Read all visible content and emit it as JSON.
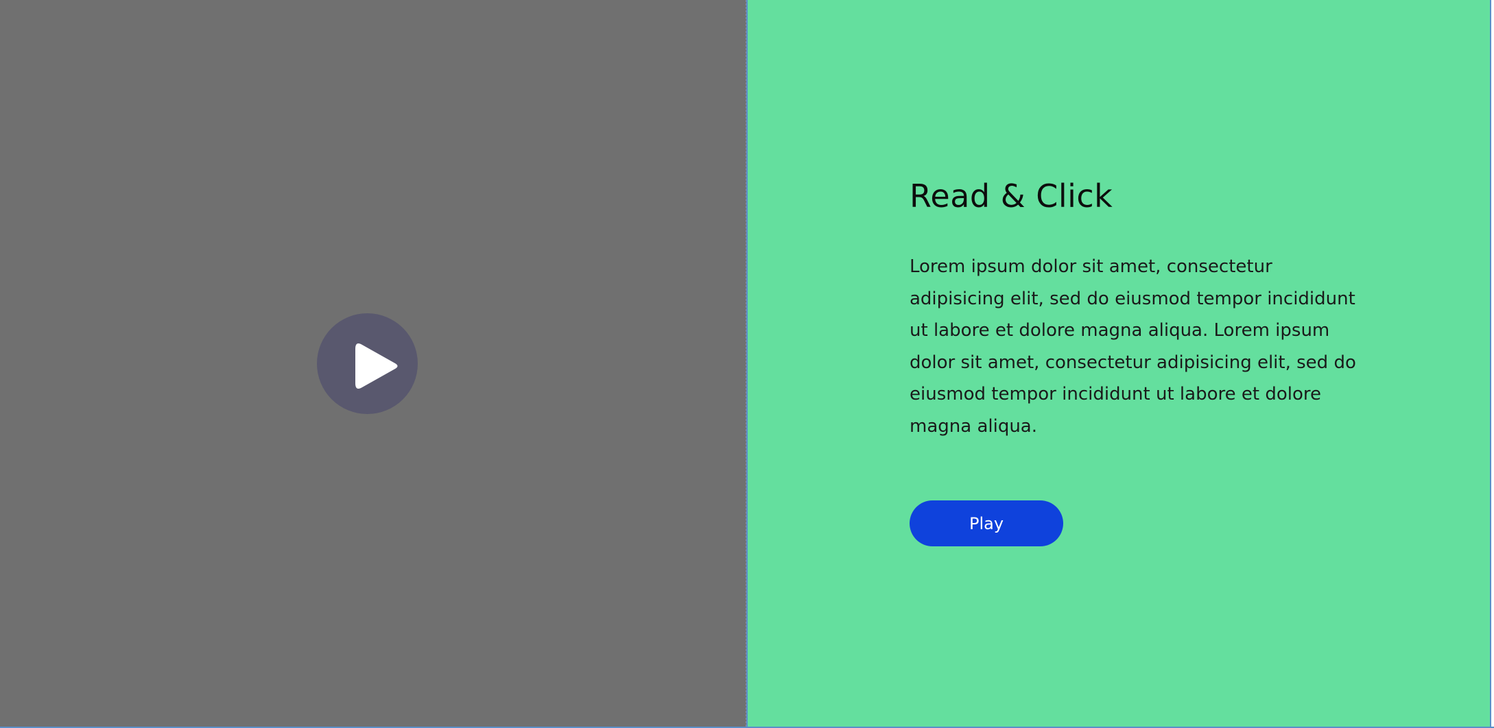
{
  "video": {
    "play_icon": "play-icon",
    "background_color": "#707070",
    "overlay_color": "#59586e"
  },
  "content": {
    "title": "Read & Click",
    "body": "Lorem ipsum dolor sit amet, consectetur adipisicing elit, sed do eiusmod tempor incididunt ut labore et dolore magna aliqua. Lorem ipsum dolor sit amet, consectetur adipisicing elit, sed do eiusmod tempor incididunt ut labore et dolore magna aliqua.",
    "button_label": "Play",
    "background_color": "#64df9e",
    "button_color": "#0f42dc"
  }
}
